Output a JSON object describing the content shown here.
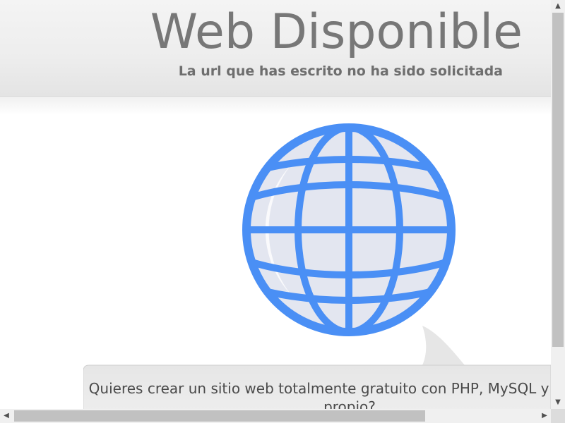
{
  "header": {
    "title": "Web Disponible",
    "subtitle": "La url que has escrito no ha sido solicitada"
  },
  "hero": {
    "icon": "globe-icon",
    "globe_color": "#4a8ff5",
    "globe_fill": "#e3e6f0"
  },
  "message": {
    "text": "Quieres crear un sitio web totalmente gratuito con PHP, MySQL y dominio propio?"
  },
  "scrollbars": {
    "up_arrow": "▲",
    "down_arrow": "▼",
    "left_arrow": "◀",
    "right_arrow": "▶"
  }
}
